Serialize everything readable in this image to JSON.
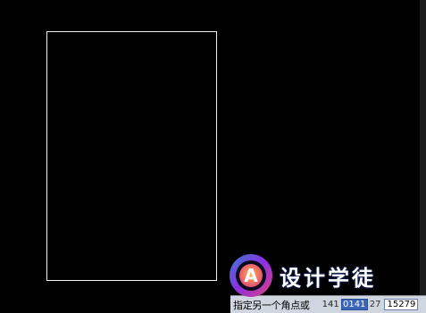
{
  "prompt": {
    "text": "指定另一个角点或",
    "coord_label": "141",
    "x_value": "0141",
    "separator": "27",
    "y_value": "15279"
  },
  "watermark": {
    "text": "设计学徒",
    "logo_letter": "A"
  },
  "colors": {
    "background": "#000000",
    "rectangle_stroke": "#f2f2f2",
    "prompt_bar": "#cfd6df",
    "active_coordinate": "#3b66b8"
  }
}
